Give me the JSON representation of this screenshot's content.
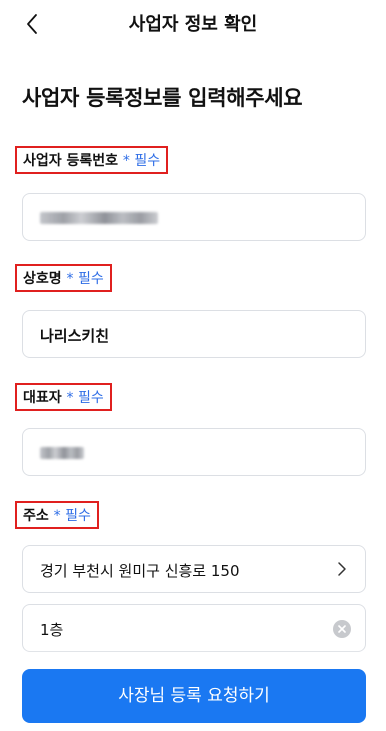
{
  "header": {
    "title": "사업자 정보 확인",
    "back_icon": "chevron-left-icon"
  },
  "section_title": "사업자 등록정보를 입력해주세요",
  "required_mark": "* 필수",
  "fields": {
    "business_number": {
      "label": "사업자 등록번호",
      "value_redacted": true
    },
    "company_name": {
      "label": "상호명",
      "value": "나리스키친"
    },
    "representative": {
      "label": "대표자",
      "value_redacted": true
    },
    "address": {
      "label": "주소",
      "value": "경기 부천시 원미구 신흥로 150",
      "detail_value": "1층"
    }
  },
  "cta": {
    "label": "사장님 등록 요청하기"
  },
  "colors": {
    "accent": "#1a78f2",
    "required": "#2e6de6",
    "highlight_box": "#e0201f"
  }
}
